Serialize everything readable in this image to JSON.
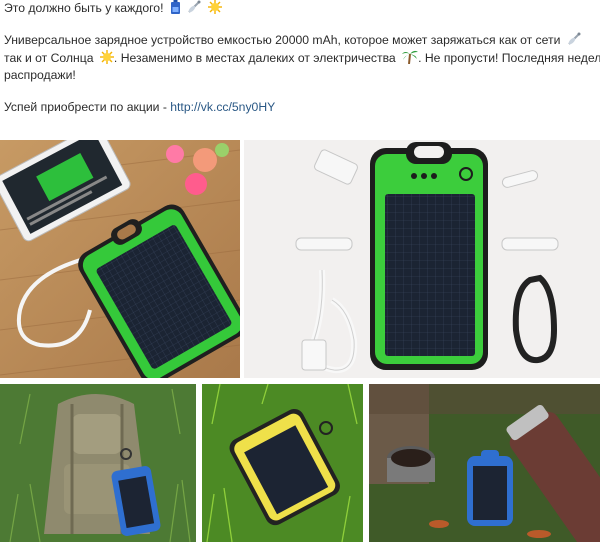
{
  "post": {
    "line1": "Это должно быть у каждого!",
    "line1_emojis": [
      "battery-icon",
      "satellite-dish-icon",
      "sun-icon"
    ],
    "line2": "Универсальное зарядное устройство емкостью 20000 mAh, которое может заряжаться как от сети",
    "line2_emojis": [
      "satellite-dish-icon"
    ],
    "line3_a": "так и от Солнца",
    "line3_b": ". Незаменимо в местах далеких от электричества",
    "line3_c": ". Не пропусти! Последняя недел",
    "line3_emojis": [
      "sun-icon",
      "palm-tree-icon"
    ],
    "line4": "распродажи!",
    "line5_prefix": "Успей приобрести по акции - ",
    "link_text": "http://vk.cc/5ny0HY"
  },
  "photos": [
    {
      "name": "photo-charger-with-phone",
      "subject": "green solar power bank charging a smartphone on wooden table"
    },
    {
      "name": "photo-charger-kit",
      "subject": "green solar power bank with adapters, cable and carabiner"
    },
    {
      "name": "photo-blue-charger-backpack",
      "subject": "blue solar charger hanging from backpack on grass"
    },
    {
      "name": "photo-yellow-charger-grass",
      "subject": "yellow solar charger lying on grass"
    },
    {
      "name": "photo-blue-charger-thermos",
      "subject": "blue solar charger next to thermos in forest"
    }
  ],
  "colors": {
    "link": "#2a5885",
    "text": "#2b2b2b",
    "charger_green": "#3cc93c",
    "charger_blue": "#2f6fd0",
    "charger_yellow": "#f0e24a"
  }
}
